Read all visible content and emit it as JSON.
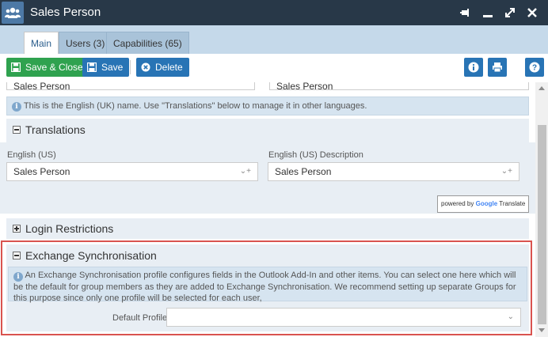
{
  "window": {
    "title": "Sales Person",
    "icon": "users-icon",
    "controls": [
      "pin-icon",
      "minimize-icon",
      "maximize-icon",
      "close-icon"
    ]
  },
  "tabs": [
    {
      "label": "Main",
      "active": true
    },
    {
      "label": "Users (3)",
      "active": false
    },
    {
      "label": "Capabilities (65)",
      "active": false
    }
  ],
  "toolbar": {
    "save_close": "Save & Close",
    "save": "Save",
    "delete": "Delete",
    "icons": [
      "info-icon",
      "print-icon",
      "help-icon"
    ]
  },
  "name_fields": {
    "name_value": "Sales Person",
    "description_value": "Sales Person"
  },
  "name_info": "This is the English (UK) name. Use \"Translations\" below to manage it in other languages.",
  "translations": {
    "header": "Translations",
    "name_label": "English (US)",
    "name_value": "Sales Person",
    "desc_label": "English (US) Description",
    "desc_value": "Sales Person",
    "powered_prefix": "powered by",
    "powered_brand": "Google",
    "powered_suffix": "Translate"
  },
  "login_restrictions": {
    "header": "Login Restrictions"
  },
  "exchange": {
    "header": "Exchange Synchronisation",
    "info": "An Exchange Synchronisation profile configures fields in the Outlook Add-In and other items. You can select one here which will be the default for group members as they are added to Exchange Synchronisation. We recommend setting up separate Groups for this purpose since only one profile will be selected for each user,",
    "default_profile_label": "Default Profile",
    "default_profile_value": ""
  },
  "colors": {
    "titlebar": "#283848",
    "tabstrip": "#c5d9ea",
    "green_button": "#2fa24f",
    "blue_button": "#2874b5",
    "highlight": "#d9534f"
  }
}
